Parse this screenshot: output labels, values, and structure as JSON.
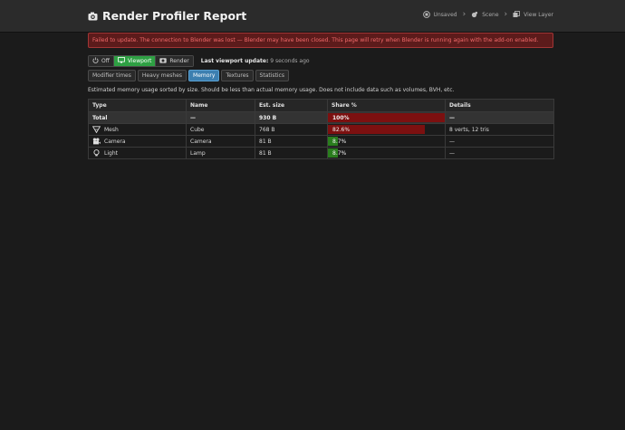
{
  "header": {
    "title": "Render Profiler Report",
    "breadcrumbs": [
      "Unsaved",
      "Scene",
      "View Layer"
    ]
  },
  "alert": {
    "text": "Failed to update. The connection to Blender was lost — Blender may have been closed. This page will retry when Blender is running again with the add-on enabled."
  },
  "mode": {
    "off_label": "Off",
    "viewport_label": "Viewport",
    "render_label": "Render",
    "active": "Viewport",
    "last_update_label": "Last viewport update:",
    "last_update_value": "9 seconds ago"
  },
  "tabs": [
    {
      "label": "Modifier times",
      "active": false
    },
    {
      "label": "Heavy meshes",
      "active": false
    },
    {
      "label": "Memory",
      "active": true
    },
    {
      "label": "Textures",
      "active": false
    },
    {
      "label": "Statistics",
      "active": false
    }
  ],
  "description": "Estimated memory usage sorted by size. Should be less than actual memory usage. Does not include data such as volumes, BVH, etc.",
  "table": {
    "headers": [
      "Type",
      "Name",
      "Est. size",
      "Share %",
      "Details"
    ],
    "rows": [
      {
        "type": "Total",
        "icon": "",
        "name": "—",
        "size": "930 B",
        "share_label": "100%",
        "share": 100,
        "details": "—",
        "color": "#7c1010"
      },
      {
        "type": "Mesh",
        "icon": "mesh-icon",
        "name": "Cube",
        "size": "768 B",
        "share_label": "82.6%",
        "share": 82.6,
        "details": "8 verts, 12 tris",
        "color": "#7c1010"
      },
      {
        "type": "Camera",
        "icon": "camera-icon",
        "name": "Camera",
        "size": "81 B",
        "share_label": "8.7%",
        "share": 8.7,
        "details": "—",
        "color": "#2a7d1e"
      },
      {
        "type": "Light",
        "icon": "light-icon",
        "name": "Lamp",
        "size": "81 B",
        "share_label": "8.7%",
        "share": 8.7,
        "details": "—",
        "color": "#2a7d1e"
      }
    ]
  }
}
